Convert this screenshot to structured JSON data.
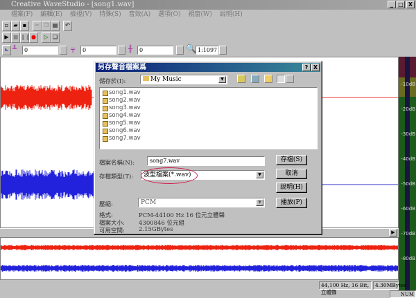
{
  "window": {
    "title": "Creative WaveStudio - [song1.wav]",
    "min": "_",
    "max": "□",
    "close": "X"
  },
  "menu": [
    "檔案(F)",
    "編輯(E)",
    "檢視(V)",
    "特殊(S)",
    "音效(A)",
    "選項(O)",
    "視窗(W)",
    "說明(H)"
  ],
  "toolbar": {
    "field1": "0",
    "field2": "0",
    "field3": "0",
    "zoom": "1:1097"
  },
  "meter": {
    "labels": [
      "-10dB",
      "-20dB",
      "-30dB",
      "-40dB",
      "-50dB",
      "-60dB",
      "-70dB",
      "-80dB"
    ]
  },
  "status": {
    "format": "44,100 Hz, 16 Bit, 立體聲",
    "size": "4.30MBytes",
    "num": "NUM"
  },
  "dialog": {
    "title": "另存聲音檔案爲",
    "help": "?",
    "close": "X",
    "save_in_label": "儲存於(I):",
    "save_in": "My Music",
    "files": [
      "song1.wav",
      "song2.wav",
      "song3.wav",
      "song4.wav",
      "song5.wav",
      "song6.wav",
      "song7.wav"
    ],
    "filename_label": "檔案名稱(N):",
    "filename": "song7.wav",
    "filetype_label": "存檔類型(T):",
    "filetype": "波型檔案(*.wav)",
    "compression_label": "壓縮:",
    "compression": "PCM",
    "format_label": "格式:",
    "format": "PCM-44100 Hz 16 位元立體聲",
    "size_label": "檔案大小:",
    "size": "4300846 位元組",
    "space_label": "可用空間:",
    "space": "2.15GBytes",
    "buttons": {
      "save": "存檔(S)",
      "cancel": "取消",
      "help": "說明(H)",
      "play": "播放(P)"
    },
    "highlight_color": "#d02050"
  }
}
